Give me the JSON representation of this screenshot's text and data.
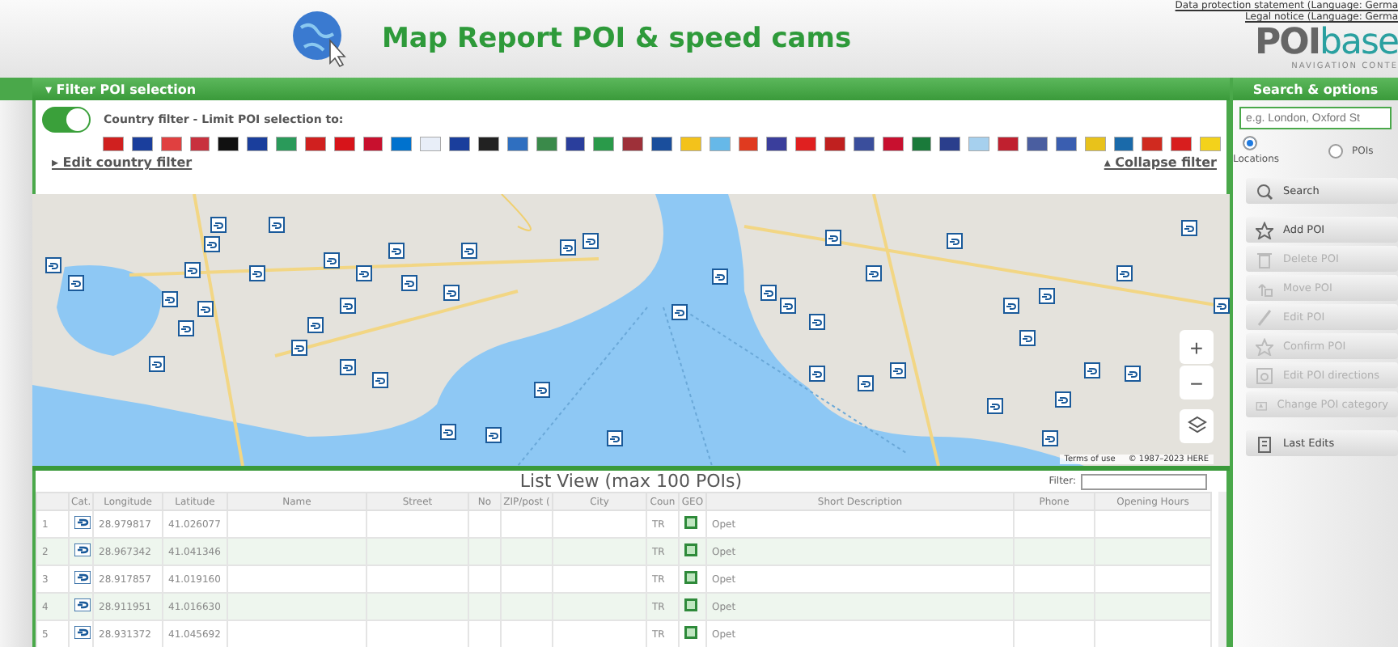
{
  "header": {
    "title": "Map Report POI & speed cams",
    "links": [
      "Data protection statement (Language: Germa",
      "Legal notice (Language: Germa"
    ],
    "logo": {
      "left": "POI",
      "right": "base",
      "tagline": "NAVIGATION CONTE"
    }
  },
  "filter_panel": {
    "title": "▾ Filter POI selection",
    "toggle": {
      "on": true,
      "label": "Country filter - Limit POI selection to:"
    },
    "flags": [
      {
        "color": "#d0201f"
      },
      {
        "color": "#1a3e9c"
      },
      {
        "color": "#e04040"
      },
      {
        "color": "#c8313e"
      },
      {
        "color": "#111111"
      },
      {
        "color": "#1a3e9c"
      },
      {
        "color": "#2a9a5a"
      },
      {
        "color": "#d0201f"
      },
      {
        "color": "#d7141a"
      },
      {
        "color": "#c8102e"
      },
      {
        "color": "#0072ce"
      },
      {
        "color": "#e8eef8"
      },
      {
        "color": "#1a3e9c"
      },
      {
        "color": "#222222"
      },
      {
        "color": "#2f6fc0"
      },
      {
        "color": "#3a8a4a"
      },
      {
        "color": "#2a3e9c"
      },
      {
        "color": "#2a9a4a"
      },
      {
        "color": "#9e3039"
      },
      {
        "color": "#1a4e9c"
      },
      {
        "color": "#f3c21b"
      },
      {
        "color": "#66b8e8"
      },
      {
        "color": "#e03a1f"
      },
      {
        "color": "#3a3e9c"
      },
      {
        "color": "#e02020"
      },
      {
        "color": "#c0201f"
      },
      {
        "color": "#3a4e9c"
      },
      {
        "color": "#c8102f"
      },
      {
        "color": "#1a7a3a"
      },
      {
        "color": "#2a3e8c"
      },
      {
        "color": "#a6d0ee"
      },
      {
        "color": "#c0202f"
      },
      {
        "color": "#4a5ea0"
      },
      {
        "color": "#3a5eb0"
      },
      {
        "color": "#e8c21b"
      },
      {
        "color": "#1a6aaa"
      },
      {
        "color": "#d02a1f"
      },
      {
        "color": "#d81e1e"
      },
      {
        "color": "#f3d21b"
      }
    ],
    "edit_link": "▸ Edit country filter",
    "collapse_link": "▴ Collapse filter"
  },
  "map": {
    "zoom_in": "+",
    "zoom_out": "−",
    "attribution": [
      "Terms of use",
      "© 1987–2023 HERE"
    ]
  },
  "list": {
    "title": "List View (max 100 POIs)",
    "filter_label": "Filter:",
    "columns": [
      "",
      "Cat.",
      "Longitude",
      "Latitude",
      "Name",
      "Street",
      "No",
      "ZIP/post (",
      "City",
      "Coun",
      "GEO",
      "Short Description",
      "Phone",
      "Opening Hours"
    ],
    "rows": [
      {
        "index": "1",
        "longitude": "28.979817",
        "latitude": "41.026077",
        "country": "TR",
        "description": "Opet"
      },
      {
        "index": "2",
        "longitude": "28.967342",
        "latitude": "41.041346",
        "country": "TR",
        "description": "Opet"
      },
      {
        "index": "3",
        "longitude": "28.917857",
        "latitude": "41.019160",
        "country": "TR",
        "description": "Opet"
      },
      {
        "index": "4",
        "longitude": "28.911951",
        "latitude": "41.016630",
        "country": "TR",
        "description": "Opet"
      },
      {
        "index": "5",
        "longitude": "28.931372",
        "latitude": "41.045692",
        "country": "TR",
        "description": "Opet"
      }
    ]
  },
  "sidebar": {
    "title": "Search & options",
    "search_placeholder": "e.g. London, Oxford St",
    "radios": [
      {
        "label": "Locations",
        "selected": true
      },
      {
        "label": "POIs",
        "selected": false
      }
    ],
    "buttons": [
      {
        "kind": "search",
        "label": "Search",
        "disabled": false
      },
      {
        "kind": "add",
        "label": "Add POI",
        "disabled": false
      },
      {
        "kind": "delete",
        "label": "Delete POI",
        "disabled": true
      },
      {
        "kind": "move",
        "label": "Move POI",
        "disabled": true
      },
      {
        "kind": "edit",
        "label": "Edit POI",
        "disabled": true
      },
      {
        "kind": "confirm",
        "label": "Confirm POI",
        "disabled": true
      },
      {
        "kind": "directions",
        "label": "Edit POI directions",
        "disabled": true
      },
      {
        "kind": "category",
        "label": "Change POI category",
        "disabled": true
      },
      {
        "kind": "history",
        "label": "Last Edits",
        "disabled": false
      }
    ]
  }
}
